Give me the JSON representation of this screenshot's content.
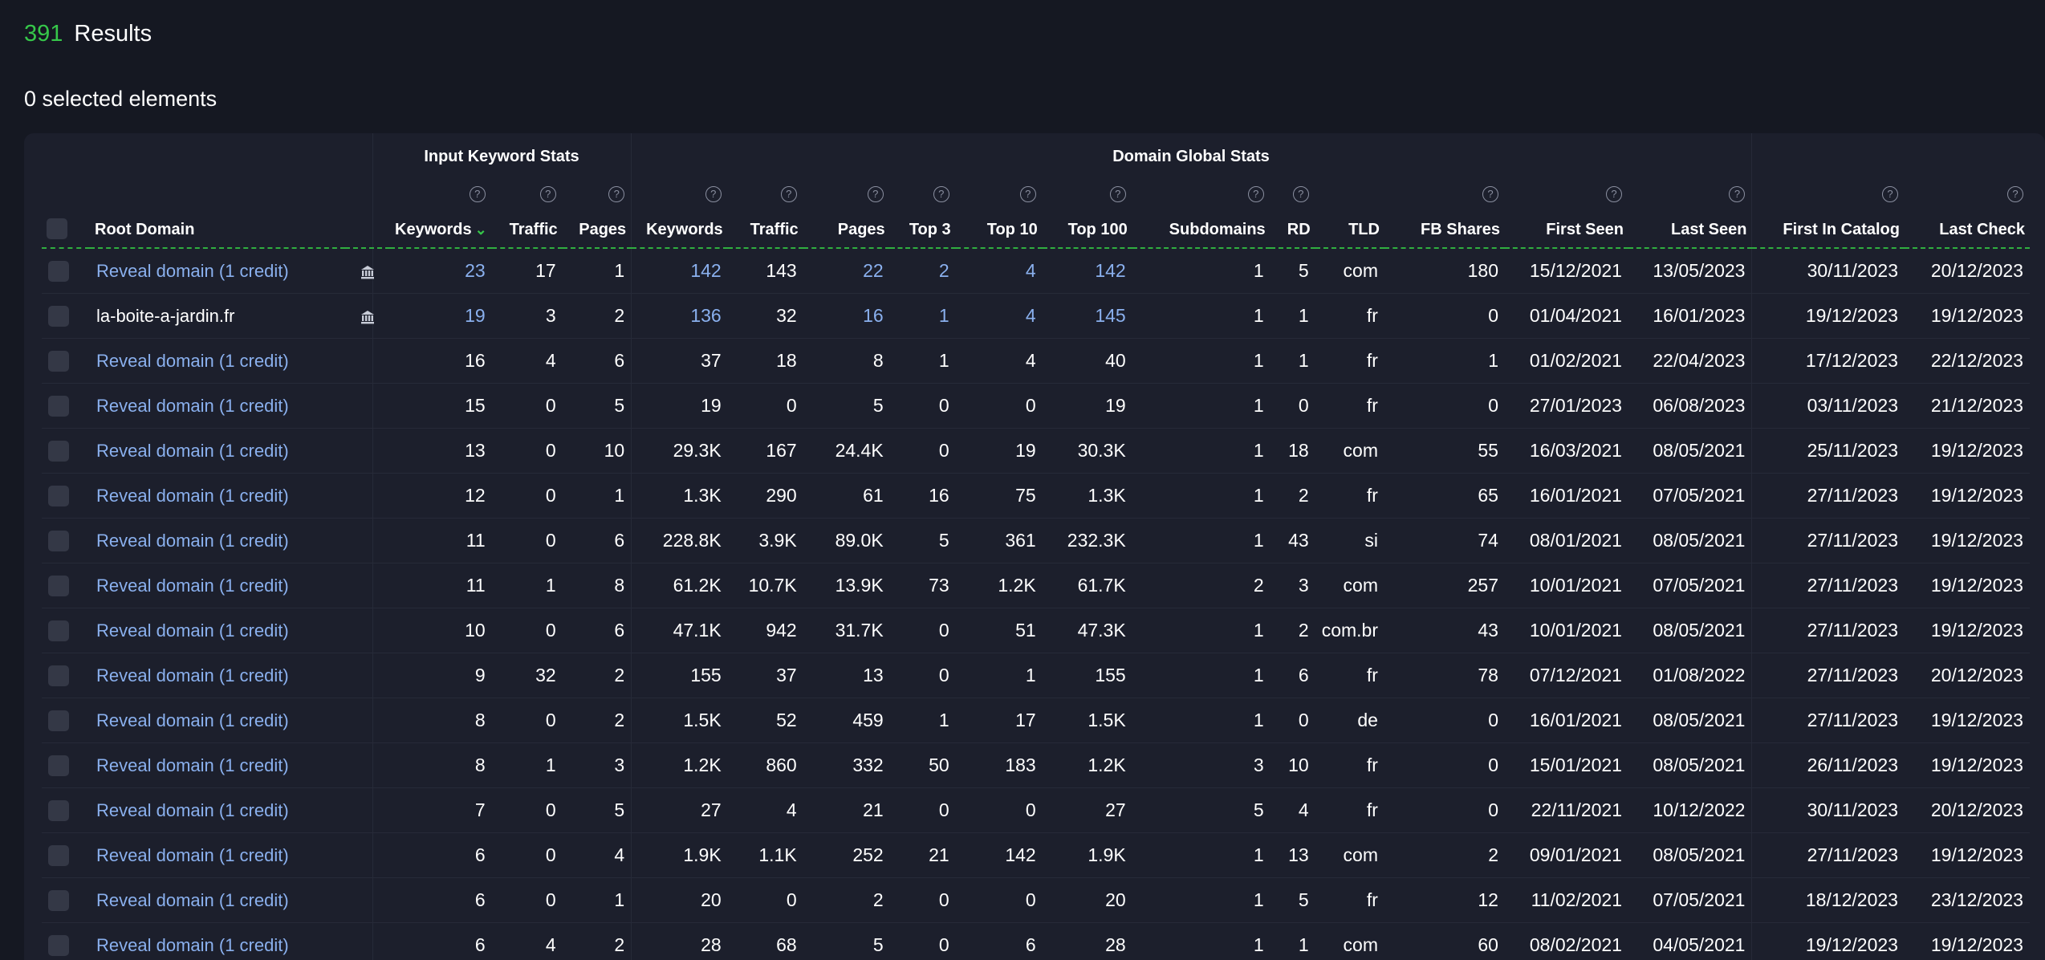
{
  "header": {
    "results_count": "391",
    "results_label": "Results",
    "selected_text": "0 selected elements"
  },
  "groups": {
    "input": "Input Keyword Stats",
    "global": "Domain Global Stats"
  },
  "columns": [
    "Root Domain",
    "Keywords",
    "Traffic",
    "Pages",
    "Keywords",
    "Traffic",
    "Pages",
    "Top 3",
    "Top 10",
    "Top 100",
    "Subdomains",
    "RD",
    "TLD",
    "FB Shares",
    "First Seen",
    "Last Seen",
    "First In Catalog",
    "Last Check"
  ],
  "colors": {
    "accent_green": "#36c74a",
    "link_blue": "#8ab0ee",
    "background": "#151822",
    "panel": "#1c1f2c"
  },
  "rows": [
    {
      "domain": "Reveal domain (1 credit)",
      "link": true,
      "trash": true,
      "blue": true,
      "c": [
        "23",
        "17",
        "1",
        "142",
        "143",
        "22",
        "2",
        "4",
        "142",
        "1",
        "5",
        "com",
        "180",
        "15/12/2021",
        "13/05/2023",
        "30/11/2023",
        "20/12/2023"
      ]
    },
    {
      "domain": "la-boite-a-jardin.fr",
      "link": false,
      "trash": true,
      "blue": true,
      "c": [
        "19",
        "3",
        "2",
        "136",
        "32",
        "16",
        "1",
        "4",
        "145",
        "1",
        "1",
        "fr",
        "0",
        "01/04/2021",
        "16/01/2023",
        "19/12/2023",
        "19/12/2023"
      ]
    },
    {
      "domain": "Reveal domain (1 credit)",
      "link": true,
      "trash": false,
      "blue": false,
      "c": [
        "16",
        "4",
        "6",
        "37",
        "18",
        "8",
        "1",
        "4",
        "40",
        "1",
        "1",
        "fr",
        "1",
        "01/02/2021",
        "22/04/2023",
        "17/12/2023",
        "22/12/2023"
      ]
    },
    {
      "domain": "Reveal domain (1 credit)",
      "link": true,
      "trash": false,
      "blue": false,
      "c": [
        "15",
        "0",
        "5",
        "19",
        "0",
        "5",
        "0",
        "0",
        "19",
        "1",
        "0",
        "fr",
        "0",
        "27/01/2023",
        "06/08/2023",
        "03/11/2023",
        "21/12/2023"
      ]
    },
    {
      "domain": "Reveal domain (1 credit)",
      "link": true,
      "trash": false,
      "blue": false,
      "c": [
        "13",
        "0",
        "10",
        "29.3K",
        "167",
        "24.4K",
        "0",
        "19",
        "30.3K",
        "1",
        "18",
        "com",
        "55",
        "16/03/2021",
        "08/05/2021",
        "25/11/2023",
        "19/12/2023"
      ]
    },
    {
      "domain": "Reveal domain (1 credit)",
      "link": true,
      "trash": false,
      "blue": false,
      "c": [
        "12",
        "0",
        "1",
        "1.3K",
        "290",
        "61",
        "16",
        "75",
        "1.3K",
        "1",
        "2",
        "fr",
        "65",
        "16/01/2021",
        "07/05/2021",
        "27/11/2023",
        "19/12/2023"
      ]
    },
    {
      "domain": "Reveal domain (1 credit)",
      "link": true,
      "trash": false,
      "blue": false,
      "c": [
        "11",
        "0",
        "6",
        "228.8K",
        "3.9K",
        "89.0K",
        "5",
        "361",
        "232.3K",
        "1",
        "43",
        "si",
        "74",
        "08/01/2021",
        "08/05/2021",
        "27/11/2023",
        "19/12/2023"
      ]
    },
    {
      "domain": "Reveal domain (1 credit)",
      "link": true,
      "trash": false,
      "blue": false,
      "c": [
        "11",
        "1",
        "8",
        "61.2K",
        "10.7K",
        "13.9K",
        "73",
        "1.2K",
        "61.7K",
        "2",
        "3",
        "com",
        "257",
        "10/01/2021",
        "07/05/2021",
        "27/11/2023",
        "19/12/2023"
      ]
    },
    {
      "domain": "Reveal domain (1 credit)",
      "link": true,
      "trash": false,
      "blue": false,
      "c": [
        "10",
        "0",
        "6",
        "47.1K",
        "942",
        "31.7K",
        "0",
        "51",
        "47.3K",
        "1",
        "2",
        "com.br",
        "43",
        "10/01/2021",
        "08/05/2021",
        "27/11/2023",
        "19/12/2023"
      ]
    },
    {
      "domain": "Reveal domain (1 credit)",
      "link": true,
      "trash": false,
      "blue": false,
      "c": [
        "9",
        "32",
        "2",
        "155",
        "37",
        "13",
        "0",
        "1",
        "155",
        "1",
        "6",
        "fr",
        "78",
        "07/12/2021",
        "01/08/2022",
        "27/11/2023",
        "20/12/2023"
      ]
    },
    {
      "domain": "Reveal domain (1 credit)",
      "link": true,
      "trash": false,
      "blue": false,
      "c": [
        "8",
        "0",
        "2",
        "1.5K",
        "52",
        "459",
        "1",
        "17",
        "1.5K",
        "1",
        "0",
        "de",
        "0",
        "16/01/2021",
        "08/05/2021",
        "27/11/2023",
        "19/12/2023"
      ]
    },
    {
      "domain": "Reveal domain (1 credit)",
      "link": true,
      "trash": false,
      "blue": false,
      "c": [
        "8",
        "1",
        "3",
        "1.2K",
        "860",
        "332",
        "50",
        "183",
        "1.2K",
        "3",
        "10",
        "fr",
        "0",
        "15/01/2021",
        "08/05/2021",
        "26/11/2023",
        "19/12/2023"
      ]
    },
    {
      "domain": "Reveal domain (1 credit)",
      "link": true,
      "trash": false,
      "blue": false,
      "c": [
        "7",
        "0",
        "5",
        "27",
        "4",
        "21",
        "0",
        "0",
        "27",
        "5",
        "4",
        "fr",
        "0",
        "22/11/2021",
        "10/12/2022",
        "30/11/2023",
        "20/12/2023"
      ]
    },
    {
      "domain": "Reveal domain (1 credit)",
      "link": true,
      "trash": false,
      "blue": false,
      "c": [
        "6",
        "0",
        "4",
        "1.9K",
        "1.1K",
        "252",
        "21",
        "142",
        "1.9K",
        "1",
        "13",
        "com",
        "2",
        "09/01/2021",
        "08/05/2021",
        "27/11/2023",
        "19/12/2023"
      ]
    },
    {
      "domain": "Reveal domain (1 credit)",
      "link": true,
      "trash": false,
      "blue": false,
      "c": [
        "6",
        "0",
        "1",
        "20",
        "0",
        "2",
        "0",
        "0",
        "20",
        "1",
        "5",
        "fr",
        "12",
        "11/02/2021",
        "07/05/2021",
        "18/12/2023",
        "23/12/2023"
      ]
    },
    {
      "domain": "Reveal domain (1 credit)",
      "link": true,
      "trash": false,
      "blue": false,
      "c": [
        "6",
        "4",
        "2",
        "28",
        "68",
        "5",
        "0",
        "6",
        "28",
        "1",
        "1",
        "com",
        "60",
        "08/02/2021",
        "04/05/2021",
        "19/12/2023",
        "19/12/2023"
      ]
    }
  ]
}
